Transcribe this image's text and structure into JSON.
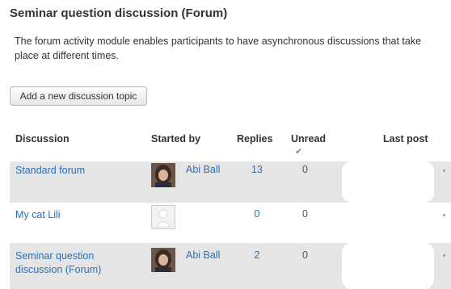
{
  "forum": {
    "title": "Seminar question discussion (Forum)",
    "intro": "The forum activity module enables participants to have asynchronous discussions that take place at different times.",
    "add_button": "Add a new discussion topic"
  },
  "table": {
    "headers": {
      "discussion": "Discussion",
      "started_by": "Started by",
      "replies": "Replies",
      "unread": "Unread",
      "last_post": "Last post"
    },
    "unread_icon": "check-icon",
    "rows": [
      {
        "discussion": "Standard forum",
        "started_by": "Abi Ball",
        "avatar": "photo",
        "replies": "13",
        "unread": "0"
      },
      {
        "discussion": "My cat Lili",
        "started_by": "",
        "avatar": "blank",
        "replies": "0",
        "unread": "0"
      },
      {
        "discussion": "Seminar question discussion (Forum)",
        "started_by": "Abi Ball",
        "avatar": "photo",
        "replies": "2",
        "unread": "0"
      }
    ]
  },
  "colors": {
    "link": "#2b6fb6",
    "row_shade": "#e5e5e5"
  }
}
